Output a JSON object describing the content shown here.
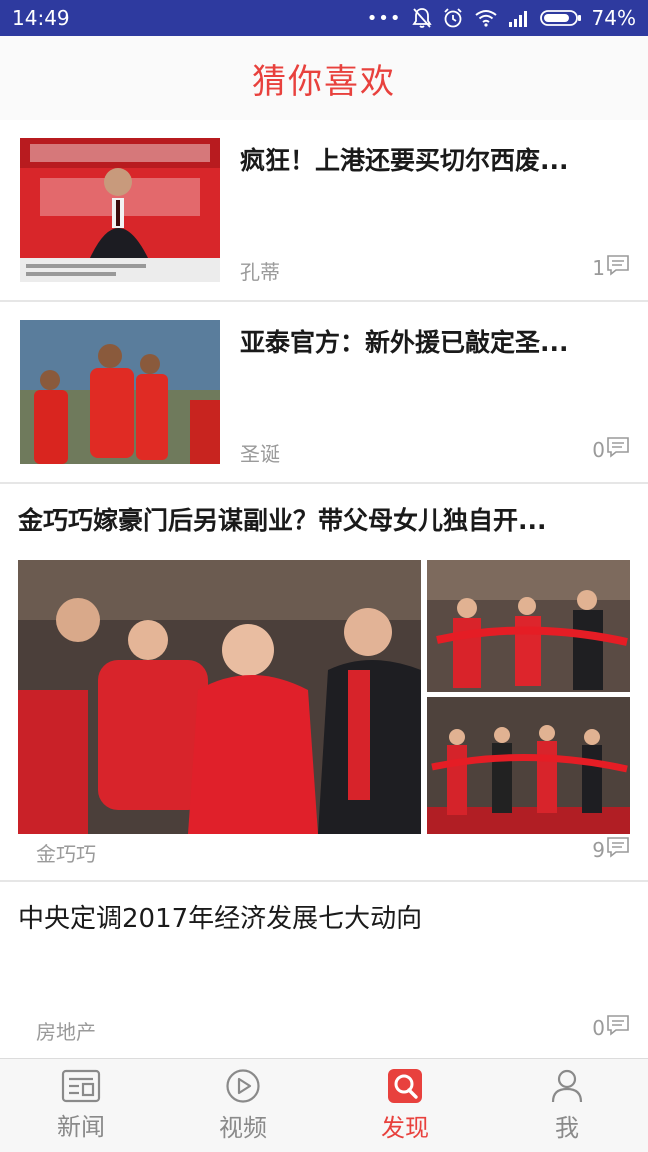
{
  "status_bar": {
    "time": "14:49",
    "battery": "74%",
    "dots": "•••"
  },
  "header": {
    "title": "猜你喜欢"
  },
  "feed": {
    "items": [
      {
        "title": "疯狂！上港还要买切尔西废...",
        "source": "孔蒂",
        "comments": "1"
      },
      {
        "title": "亚泰官方：新外援已敲定圣...",
        "source": "圣诞",
        "comments": "0"
      },
      {
        "title": "金巧巧嫁豪门后另谋副业？带父母女儿独自开...",
        "source": "金巧巧",
        "comments": "9"
      },
      {
        "title": "中央定调2017年经济发展七大动向",
        "source": "房地产",
        "comments": "0"
      }
    ]
  },
  "nav": {
    "items": [
      {
        "label": "新闻",
        "icon": "news-icon"
      },
      {
        "label": "视频",
        "icon": "video-play-icon"
      },
      {
        "label": "发现",
        "icon": "discover-search-icon"
      },
      {
        "label": "我",
        "icon": "user-icon"
      }
    ],
    "active_index": 2
  },
  "colors": {
    "accent": "#e8413d",
    "status_bar": "#2e3a9f"
  }
}
